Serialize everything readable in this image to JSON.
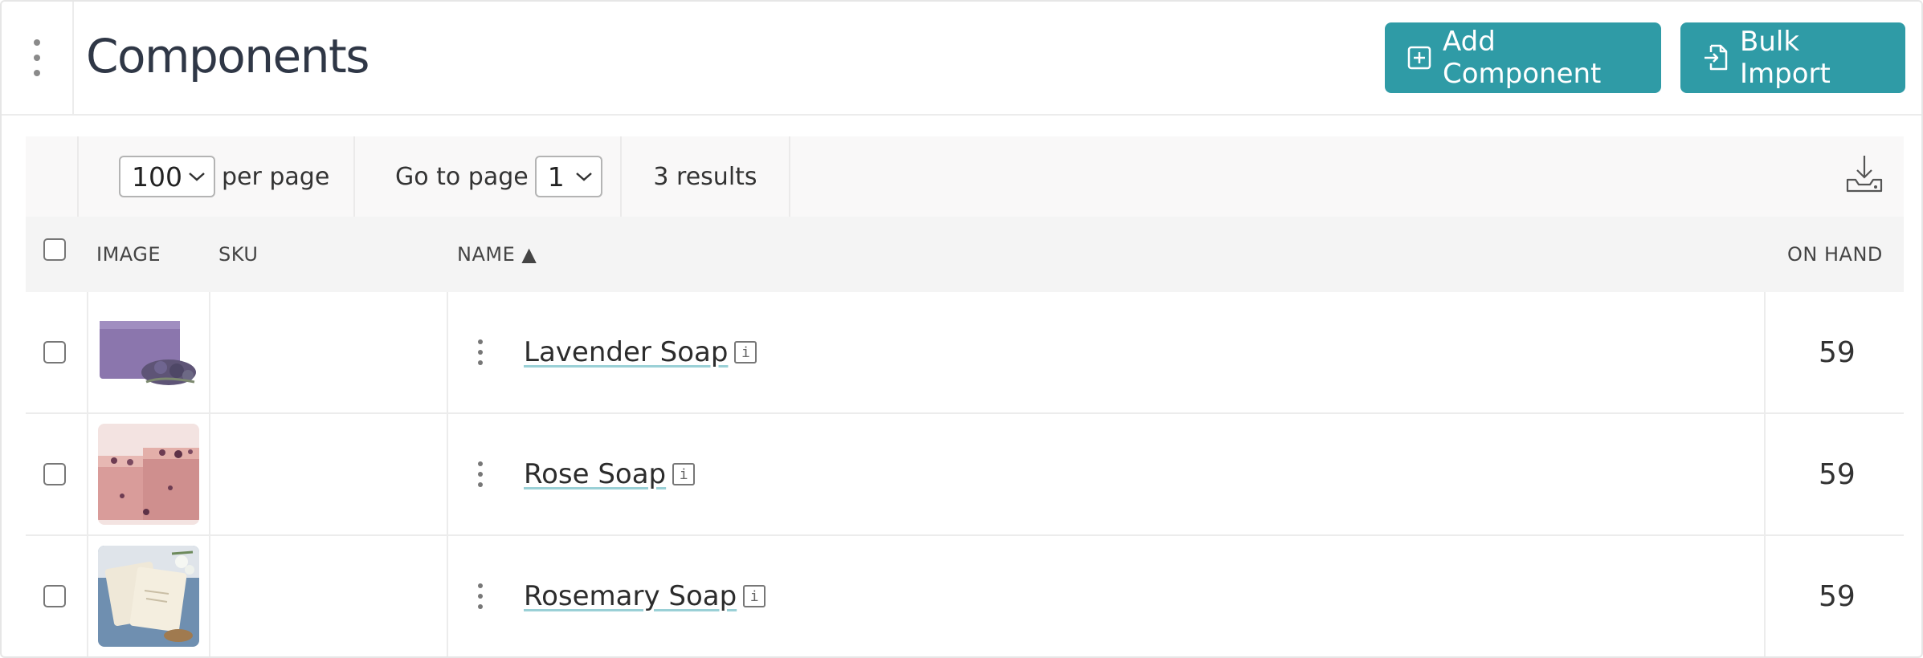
{
  "header": {
    "title": "Components",
    "add_label": "Add Component",
    "bulk_label": "Bulk Import",
    "accent_color": "#2f9ba6"
  },
  "toolbar": {
    "per_page_value": "100",
    "per_page_label": "per page",
    "goto_label": "Go to page",
    "page_value": "1",
    "results_text": "3 results",
    "download_icon": "download-tray-icon"
  },
  "table": {
    "columns": {
      "image": "IMAGE",
      "sku": "SKU",
      "name": "NAME ▲",
      "onhand": "ON HAND"
    },
    "rows": [
      {
        "sku": "",
        "name": "Lavender Soap",
        "info": "i",
        "on_hand": "59",
        "image": "lavender-soap-image"
      },
      {
        "sku": "",
        "name": "Rose Soap",
        "info": "i",
        "on_hand": "59",
        "image": "rose-soap-image"
      },
      {
        "sku": "",
        "name": "Rosemary Soap",
        "info": "i",
        "on_hand": "59",
        "image": "rosemary-soap-image"
      }
    ]
  }
}
